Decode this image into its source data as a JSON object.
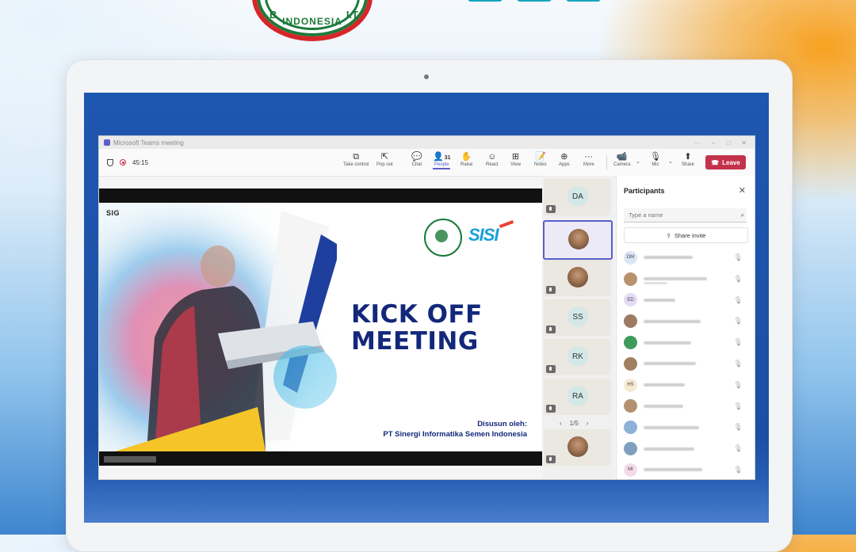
{
  "background": {
    "logo_text": "INDONESIA",
    "logo_side_left": "B",
    "logo_side_right": "I.T",
    "accent_orange": "#f7a11f",
    "accent_blue": "#3f86cf"
  },
  "window": {
    "title": "Microsoft Teams meeting"
  },
  "toolbar": {
    "timer": "45:15",
    "take_control": "Take control",
    "pop_out": "Pop out",
    "chat": "Chat",
    "people": "People",
    "people_count": "31",
    "raise": "Raise",
    "react": "React",
    "view": "View",
    "notes": "Notes",
    "apps": "Apps",
    "more": "More",
    "camera": "Camera",
    "mic": "Mic",
    "share": "Share",
    "leave": "Leave",
    "leave_color": "#c4314b",
    "accent_color": "#5b5fc7"
  },
  "slide": {
    "brand": "SIG",
    "sisi_logo": "SISI",
    "headline_line1": "KICK OFF",
    "headline_line2": "MEETING",
    "prepared_by": "Disusun oleh:",
    "company": "PT Sinergi Informatika Semen Indonesia"
  },
  "gallery": {
    "tiles": [
      {
        "initials": "DA",
        "photo": false,
        "selected": false
      },
      {
        "initials": "",
        "photo": true,
        "selected": true
      },
      {
        "initials": "",
        "photo": true,
        "selected": false
      },
      {
        "initials": "SS",
        "photo": false,
        "selected": false
      },
      {
        "initials": "RK",
        "photo": false,
        "selected": false
      },
      {
        "initials": "RA",
        "photo": false,
        "selected": false
      },
      {
        "initials": "",
        "photo": true,
        "selected": false
      }
    ],
    "pager": "1/5"
  },
  "participants": {
    "title": "Participants",
    "search_placeholder": "Type a name",
    "share_invite": "Share invite",
    "rows": [
      {
        "initials": "DM",
        "color": "#dbe6f5"
      },
      {
        "initials": "",
        "color": "#b8926f"
      },
      {
        "initials": "ED",
        "color": "#e3dcf3"
      },
      {
        "initials": "",
        "color": "#9c7a63"
      },
      {
        "initials": "",
        "color": "#3f9b5a"
      },
      {
        "initials": "",
        "color": "#a08060"
      },
      {
        "initials": "HS",
        "color": "#f6ead2"
      },
      {
        "initials": "",
        "color": "#b49070"
      },
      {
        "initials": "",
        "color": "#8fb0d8"
      },
      {
        "initials": "",
        "color": "#7f9fbf"
      },
      {
        "initials": "MI",
        "color": "#f3dce7"
      }
    ]
  }
}
